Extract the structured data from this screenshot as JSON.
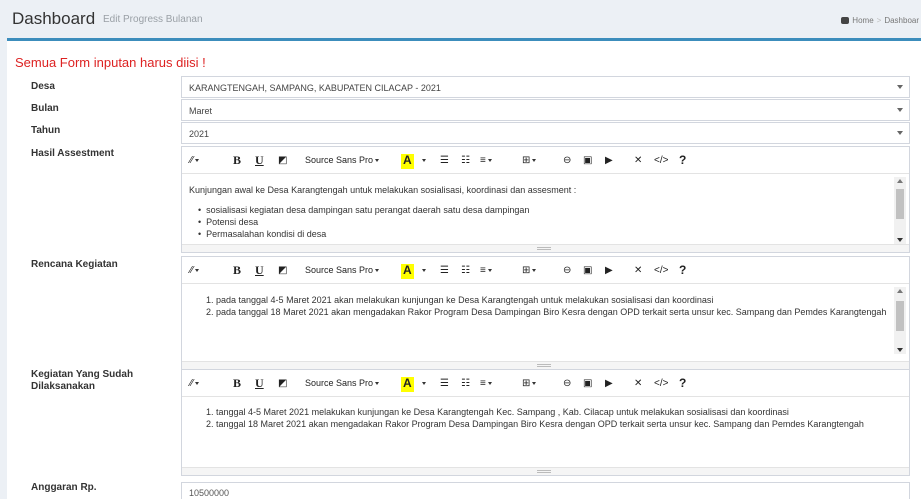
{
  "header": {
    "title": "Dashboard",
    "subtitle": "Edit Progress Bulanan",
    "breadcrumb": {
      "home": "Home",
      "current": "Dashboar"
    }
  },
  "form": {
    "warning": "Semua Form inputan harus diisi !",
    "desa": {
      "label": "Desa",
      "value": "KARANGTENGAH, SAMPANG, KABUPATEN CILACAP - 2021"
    },
    "bulan": {
      "label": "Bulan",
      "value": "Maret"
    },
    "tahun": {
      "label": "Tahun",
      "value": "2021"
    },
    "hasil": {
      "label": "Hasil Assestment",
      "intro": "Kunjungan awal ke Desa Karangtengah untuk melakukan sosialisasi, koordinasi dan assesment :",
      "bullets": [
        "sosialisasi kegiatan desa dampingan satu perangat daerah satu desa dampingan",
        "Potensi desa",
        "Permasalahan kondisi di desa"
      ]
    },
    "rencana": {
      "label": "Rencana Kegiatan",
      "lines": [
        "1. pada tanggal 4-5 Maret 2021 akan melakukan kunjungan ke Desa Karangtengah untuk melakukan sosialisasi dan koordinasi",
        "2. pada tanggal 18 Maret 2021 akan mengadakan Rakor Program Desa Dampingan Biro Kesra dengan OPD terkait serta unsur kec. Sampang dan Pemdes Karangtengah"
      ]
    },
    "kegiatan": {
      "label_line1": "Kegiatan Yang Sudah",
      "label_line2": "Dilaksanakan",
      "lines": [
        "1. tanggal 4-5 Maret 2021 melakukan kunjungan ke Desa Karangtengah Kec. Sampang , Kab. Cilacap  untuk melakukan sosialisasi dan koordinasi",
        "2. tanggal 18 Maret 2021 akan mengadakan Rakor Program Desa Dampingan Biro Kesra dengan OPD terkait serta unsur kec. Sampang dan Pemdes Karangtengah"
      ]
    },
    "anggaran": {
      "label": "Anggaran Rp.",
      "value": "10500000"
    }
  },
  "toolbar": {
    "font_name": "Source Sans Pro",
    "bold": "B",
    "underline": "U",
    "highlight": "A",
    "code": "</>",
    "help": "?",
    "icons": [
      "magic-icon",
      "eraser-icon",
      "unordered-list-icon",
      "ordered-list-icon",
      "paragraph-align-icon",
      "table-icon",
      "link-icon",
      "picture-icon",
      "video-icon",
      "fullscreen-icon"
    ]
  },
  "colors": {
    "accent": "#3c8dbc",
    "warning": "#dd2222",
    "highlight": "#ffff00"
  }
}
